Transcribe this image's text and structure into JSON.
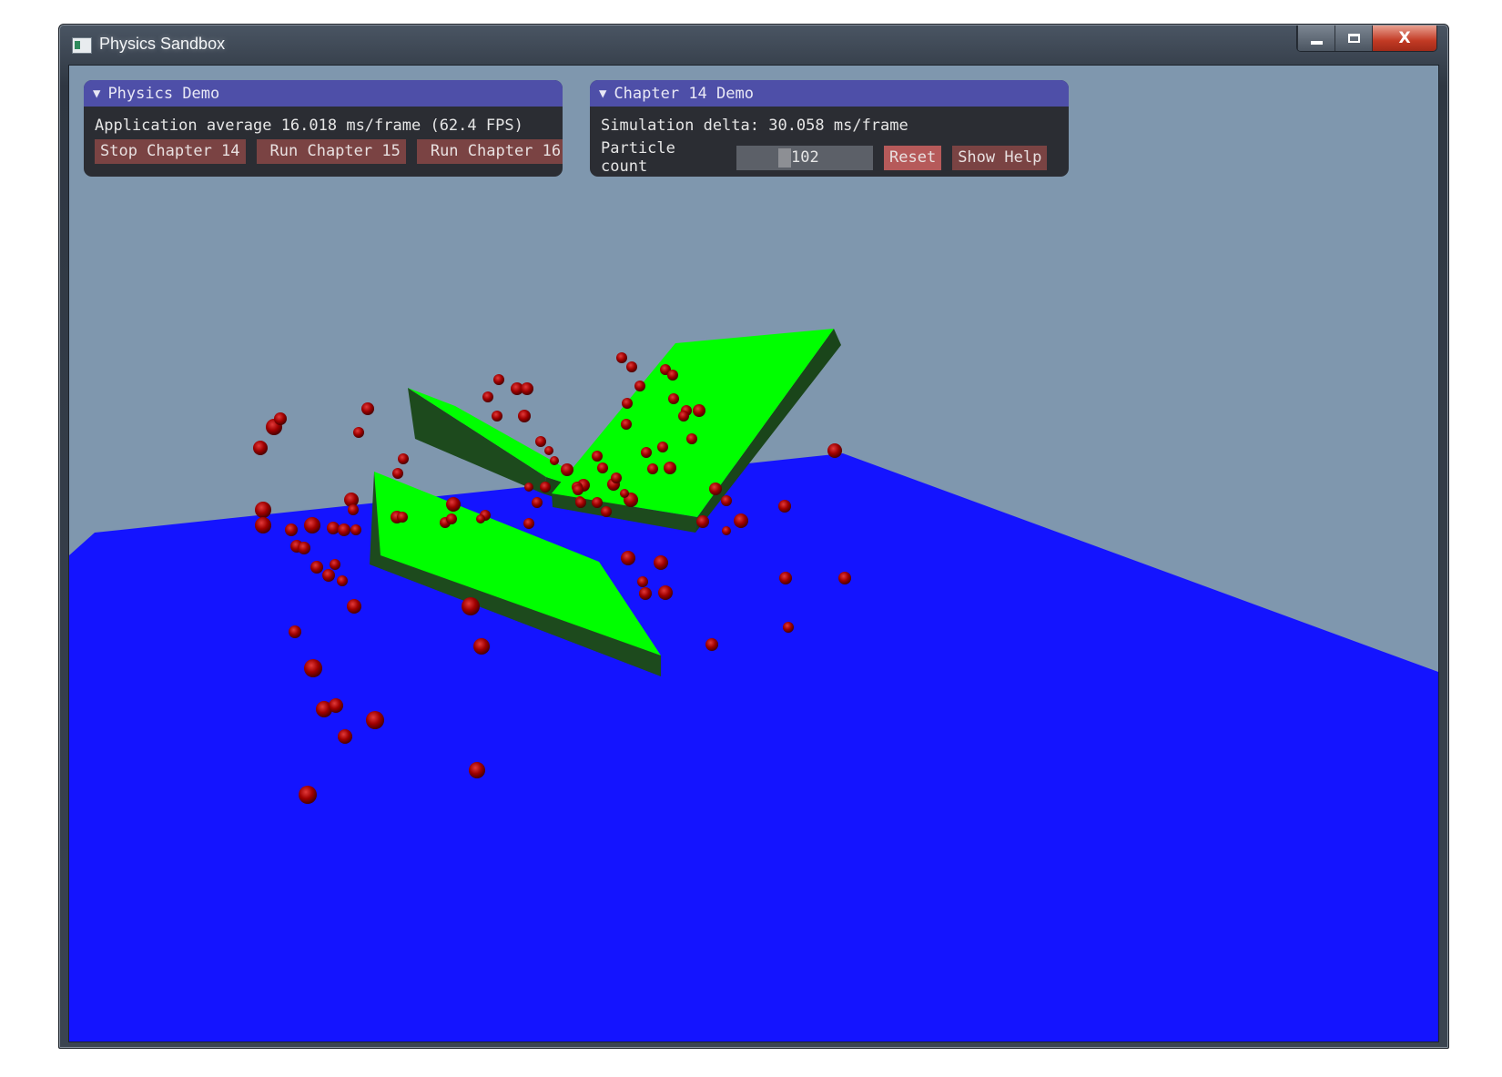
{
  "window": {
    "title": "Physics Sandbox",
    "controls": {
      "minimize": "minimize",
      "maximize": "maximize",
      "close": "X"
    }
  },
  "physics_panel": {
    "title": "Physics Demo",
    "stats": "Application average 16.018 ms/frame (62.4 FPS)",
    "buttons": [
      "Stop Chapter 14",
      "Run Chapter 15",
      "Run Chapter 16"
    ]
  },
  "demo_panel": {
    "title": "Chapter 14 Demo",
    "sim_delta": "Simulation delta: 30.058 ms/frame",
    "particle_label": "Particle count",
    "particle_count": "102",
    "reset_label": "Reset",
    "help_label": "Show Help"
  },
  "scene": {
    "sky_color": "#7f97ae",
    "ground_color": "#1414ff",
    "box_top_color": "#00ff00",
    "box_side_color": "#1d4a1d",
    "particle_color": "#a00000"
  }
}
